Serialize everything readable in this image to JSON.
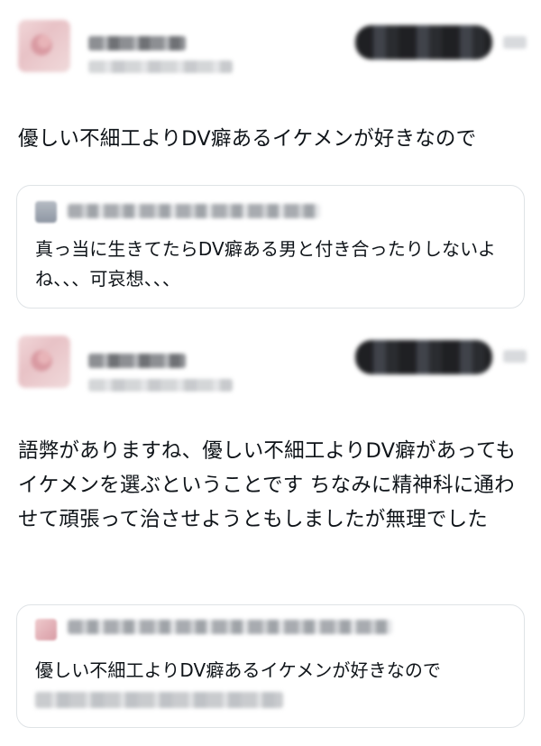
{
  "reply_1": {
    "text": "優しい不細工よりDV癖あるイケメンが好きなので",
    "quoted": {
      "text": "真っ当に生きてたらDV癖ある男と付き合ったりしないよね、、、可哀想、、、"
    }
  },
  "reply_2": {
    "text": "語弊がありますね、優しい不細工よりDV癖があってもイケメンを選ぶということです ちなみに精神科に通わせて頑張って治させようともしましたが無理でした",
    "quoted": {
      "text": "優しい不細工よりDV癖あるイケメンが好きなので"
    }
  }
}
